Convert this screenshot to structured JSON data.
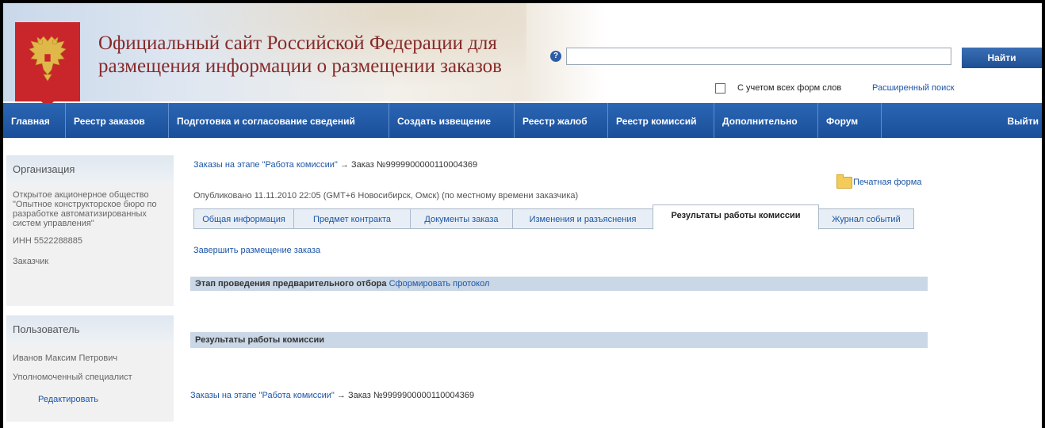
{
  "header": {
    "site_title": "Официальный сайт Российской Федерации для размещения информации о размещении заказов",
    "search_placeholder": "",
    "find_button": "Найти",
    "all_forms_label": "С учетом всех форм слов",
    "advanced_search": "Расширенный поиск",
    "help_icon": "?"
  },
  "nav": {
    "items": [
      "Главная",
      "Реестр заказов",
      "Подготовка и согласование сведений",
      "Создать извещение",
      "Реестр жалоб",
      "Реестр комиссий",
      "Дополнительно",
      "Форум"
    ],
    "logout": "Выйти"
  },
  "sidebar": {
    "organization": {
      "title": "Организация",
      "name": "Открытое акционерное общество \"Опытное конструкторское бюро по разработке автоматизированных систем управления\"",
      "inn": "ИНН 5522288885",
      "role": "Заказчик"
    },
    "user": {
      "title": "Пользователь",
      "name": "Иванов Максим Петрович",
      "role": "Уполномоченный специалист",
      "edit": "Редактировать"
    }
  },
  "main": {
    "breadcrumb": {
      "stage_link": "Заказы на этапе \"Работа комиссии\"",
      "arrow": "→",
      "order": "Заказ №9999900000110004369"
    },
    "print_form": "Печатная форма",
    "published": "Опубликовано 11.11.2010 22:05 (GMT+6 Новосибирск, Омск) (по местному времени заказчика)",
    "tabs": [
      "Общая информация",
      "Предмет контракта",
      "Документы заказа",
      "Изменения и разъяснения",
      "Результаты работы комиссии",
      "Журнал событий"
    ],
    "active_tab": "Результаты работы комиссии",
    "finish_link": "Завершить размещение заказа",
    "section1_title": "Этап проведения предварительного отбора",
    "section1_link": "Сформировать протокол",
    "section2_title": "Результаты работы комиссии"
  },
  "colors": {
    "nav_bg": "#1e55a0",
    "link": "#1d56a6",
    "title": "#862a2a",
    "emblem": "#c8262b",
    "section_bar": "#c9d7e6"
  }
}
